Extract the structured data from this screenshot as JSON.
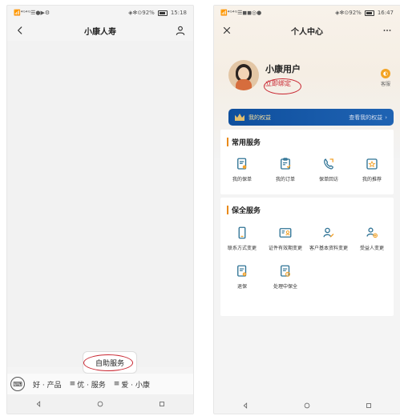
{
  "left": {
    "status": {
      "left": "📶⁴ᴳ⁴ᴳ☰●▶⚙",
      "right": "◈✻⊙92%",
      "time": "15:18"
    },
    "title": "小康人寿",
    "self_service": "自助服务",
    "menu": {
      "item1": "好 · 产品",
      "item2": "优 · 服务",
      "item3": "爱 · 小康"
    }
  },
  "right": {
    "status": {
      "left": "📶⁴ᴳ⁴ᴳ☰◼◼◎●",
      "right": "◈✻⊙92%",
      "time": "16:47"
    },
    "title": "个人中心",
    "profile": {
      "name": "小康用户",
      "bind": "立即绑定"
    },
    "service_label": "客服",
    "rights": {
      "title": "我的权益",
      "link": "查看我的权益"
    },
    "common_services": {
      "title": "常用服务",
      "items": [
        {
          "label": "我的保单"
        },
        {
          "label": "我的订单"
        },
        {
          "label": "保单回访"
        },
        {
          "label": "我的推荐"
        }
      ]
    },
    "security_services": {
      "title": "保全服务",
      "items": [
        {
          "label": "联系方式变更"
        },
        {
          "label": "证件有效期变更"
        },
        {
          "label": "客户基本资料变更"
        },
        {
          "label": "受益人变更"
        },
        {
          "label": "退保"
        },
        {
          "label": "处理中保全"
        }
      ]
    }
  },
  "colors": {
    "accent_red": "#c8242f",
    "accent_orange": "#e98a18",
    "rights_blue": "#1f63b3"
  },
  "icons": {
    "left_header": [
      "back-icon",
      "user-icon"
    ],
    "right_header": [
      "close-icon",
      "more-icon"
    ],
    "nav": [
      "back-triangle-icon",
      "home-circle-icon",
      "square-icon"
    ]
  }
}
